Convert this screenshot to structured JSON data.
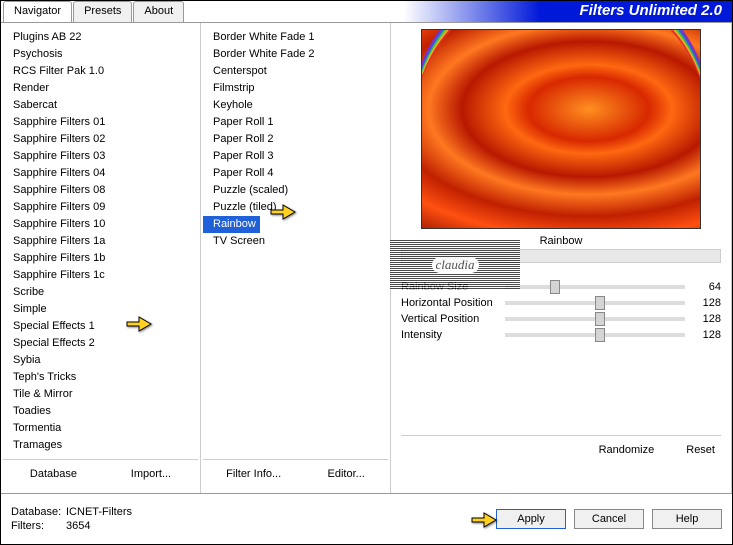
{
  "title": "Filters Unlimited 2.0",
  "tabs": {
    "t0": "Navigator",
    "t1": "Presets",
    "t2": "About"
  },
  "categories": [
    "Plugins AB 22",
    "Psychosis",
    "RCS Filter Pak 1.0",
    "Render",
    "Sabercat",
    "Sapphire Filters 01",
    "Sapphire Filters 02",
    "Sapphire Filters 03",
    "Sapphire Filters 04",
    "Sapphire Filters 08",
    "Sapphire Filters 09",
    "Sapphire Filters 10",
    "Sapphire Filters 1a",
    "Sapphire Filters 1b",
    "Sapphire Filters 1c",
    "Scribe",
    "Simple",
    "Special Effects 1",
    "Special Effects 2",
    "Sybia",
    "Teph's Tricks",
    "Tile & Mirror",
    "Toadies",
    "Tormentia",
    "Tramages"
  ],
  "filters": [
    "Border White Fade 1",
    "Border White Fade 2",
    "Centerspot",
    "Filmstrip",
    "Keyhole",
    "Paper Roll 1",
    "Paper Roll 2",
    "Paper Roll 3",
    "Paper Roll 4",
    "Puzzle (scaled)",
    "Puzzle (tiled)",
    "Rainbow",
    "TV Screen"
  ],
  "selected_filter": "Rainbow",
  "preview_label": "Rainbow",
  "params": {
    "p0": {
      "label": "Rainbow Size",
      "value": "64",
      "pos": 25
    },
    "p1": {
      "label": "Horizontal Position",
      "value": "128",
      "pos": 50
    },
    "p2": {
      "label": "Vertical Position",
      "value": "128",
      "pos": 50
    },
    "p3": {
      "label": "Intensity",
      "value": "128",
      "pos": 50
    }
  },
  "buttons": {
    "database": "Database",
    "import": "Import...",
    "filterinfo": "Filter Info...",
    "editor": "Editor...",
    "randomize": "Randomize",
    "reset": "Reset",
    "apply": "Apply",
    "cancel": "Cancel",
    "help": "Help"
  },
  "status": {
    "db_label": "Database:",
    "db_value": "ICNET-Filters",
    "flt_label": "Filters:",
    "flt_value": "3654"
  },
  "watermark": "claudia"
}
